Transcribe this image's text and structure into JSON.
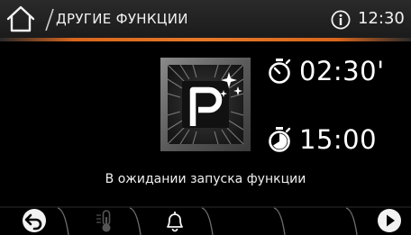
{
  "header": {
    "title": "ДРУГИЕ ФУНКЦИИ",
    "time": "12:30",
    "home_icon": "home-icon",
    "info_icon": "info-icon"
  },
  "colors": {
    "accent": "#e8792a",
    "background": "#000000",
    "text": "#ffffff"
  },
  "program": {
    "icon": "parking-keep-warm-icon",
    "letter": "P"
  },
  "timers": [
    {
      "icon": "duration-timer-icon",
      "value": "02:30'"
    },
    {
      "icon": "end-time-timer-icon",
      "value": "15:00"
    }
  ],
  "status": {
    "text": "В ожидании запуска функции"
  },
  "bottom_bar": {
    "buttons": [
      {
        "icon": "back-arrow-icon",
        "enabled": true
      },
      {
        "icon": "thermometer-icon",
        "enabled": false
      },
      {
        "icon": "bell-icon",
        "enabled": true
      },
      {
        "icon": "play-icon",
        "enabled": true
      }
    ]
  }
}
